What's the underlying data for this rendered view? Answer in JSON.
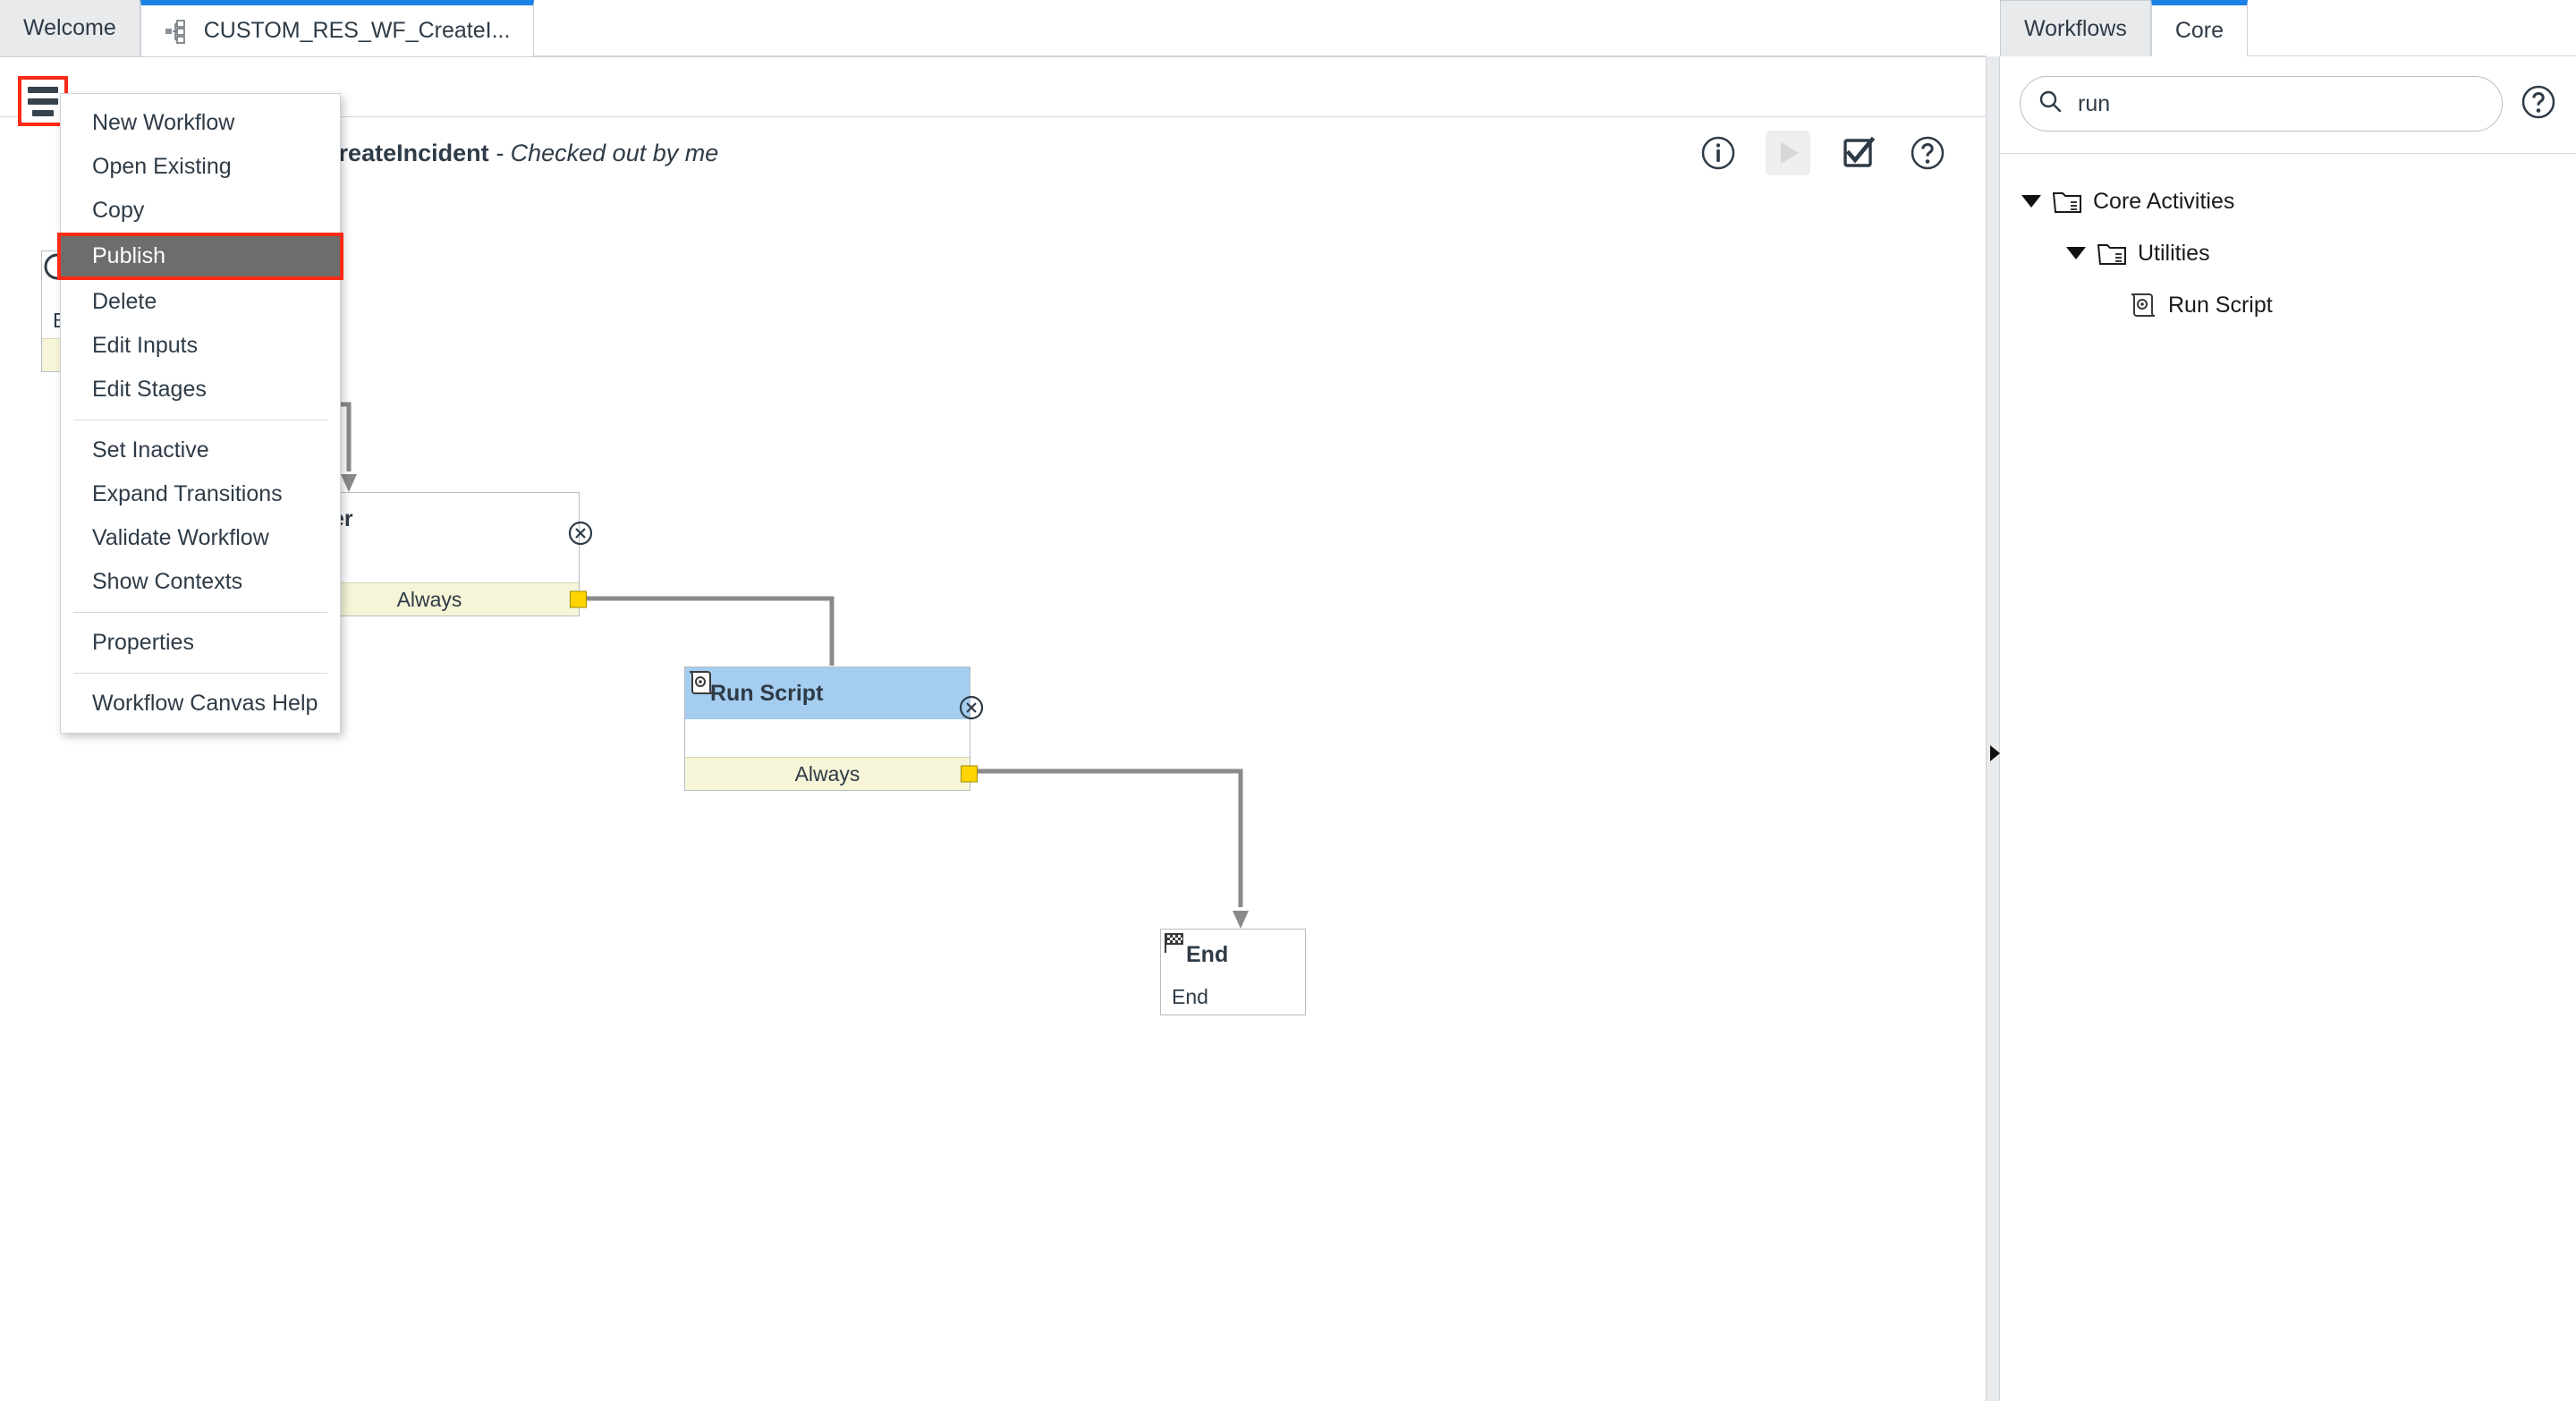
{
  "window": {
    "tabs": [
      {
        "label": "Welcome",
        "icon": "none",
        "active": false
      },
      {
        "label": "CUSTOM_RES_WF_CreateI...",
        "icon": "workflow-icon",
        "active": true
      }
    ]
  },
  "editor": {
    "title": "CUSTOM_RES_WF_CreateIncident",
    "status": "- Checked out by me",
    "menu_button_icon": "hamburger-icon",
    "tools": [
      {
        "name": "info-icon",
        "label": "Info",
        "disabled": false
      },
      {
        "name": "play-icon",
        "label": "Run",
        "disabled": true
      },
      {
        "name": "checkbox-check-icon",
        "label": "Validate",
        "disabled": false
      },
      {
        "name": "help-circle-icon",
        "label": "Help",
        "disabled": false
      }
    ]
  },
  "menu": {
    "groups": [
      {
        "items": [
          {
            "label": "New Workflow",
            "selected": false
          },
          {
            "label": "Open Existing",
            "selected": false
          },
          {
            "label": "Copy",
            "selected": false
          },
          {
            "label": "Publish",
            "selected": true
          },
          {
            "label": "Delete",
            "selected": false
          },
          {
            "label": "Edit Inputs",
            "selected": false
          },
          {
            "label": "Edit Stages",
            "selected": false
          }
        ]
      },
      {
        "items": [
          {
            "label": "Set Inactive",
            "selected": false
          },
          {
            "label": "Expand Transitions",
            "selected": false
          },
          {
            "label": "Validate Workflow",
            "selected": false
          },
          {
            "label": "Show Contexts",
            "selected": false
          }
        ]
      },
      {
        "items": [
          {
            "label": "Properties",
            "selected": false
          }
        ]
      },
      {
        "items": [
          {
            "label": "Workflow Canvas Help",
            "selected": false
          }
        ]
      }
    ]
  },
  "canvas": {
    "nodes": [
      {
        "id": "begin",
        "title": "B",
        "icon": "circle-icon",
        "transition": "",
        "header_style": "plain"
      },
      {
        "id": "timer",
        "title": "Timer",
        "icon": "timer-icon",
        "transition": "Always",
        "header_style": "plain"
      },
      {
        "id": "run-script",
        "title": "Run Script",
        "icon": "script-icon",
        "transition": "Always",
        "header_style": "blue"
      },
      {
        "id": "end",
        "title": "End",
        "subtitle": "End",
        "icon": "checkered-flag-icon",
        "header_style": "plain"
      }
    ]
  },
  "right_panel": {
    "tabs": [
      {
        "label": "Workflows",
        "active": false
      },
      {
        "label": "Core",
        "active": true
      }
    ],
    "search": {
      "value": "run",
      "placeholder": "Search",
      "icon": "search-icon",
      "help_icon": "help-circle-icon"
    },
    "tree": [
      {
        "label": "Core Activities",
        "level": 0,
        "expanded": true,
        "icon": "folder-icon"
      },
      {
        "label": "Utilities",
        "level": 1,
        "expanded": true,
        "icon": "folder-icon"
      },
      {
        "label": "Run Script",
        "level": 2,
        "expanded": null,
        "icon": "script-icon"
      }
    ]
  },
  "colors": {
    "accent_blue": "#1c82e6",
    "node_header_blue": "#a5cdf0",
    "transition_yellow": "#f6f5d7",
    "port_yellow": "#ffd400",
    "highlight_red": "#ff2a16",
    "menu_selected_gray": "#6d6d6d"
  }
}
